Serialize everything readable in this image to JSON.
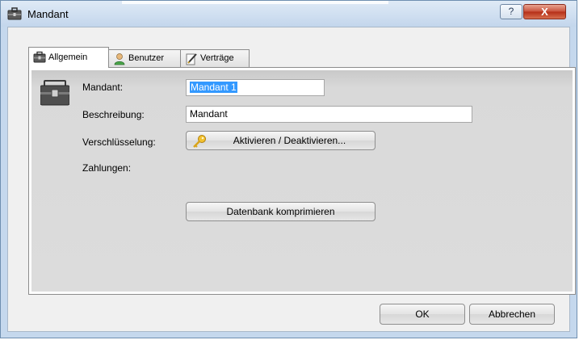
{
  "window": {
    "title": "Mandant",
    "help_label": "?",
    "close_label": "X"
  },
  "tabs": [
    {
      "label": "Allgemein",
      "icon": "briefcase-icon",
      "active": true
    },
    {
      "label": "Benutzer",
      "icon": "user-icon",
      "active": false
    },
    {
      "label": "Verträge",
      "icon": "pen-paper-icon",
      "active": false
    }
  ],
  "form": {
    "mandant_label": "Mandant:",
    "mandant_value": "Mandant 1",
    "beschreibung_label": "Beschreibung:",
    "beschreibung_value": "Mandant",
    "verschluesselung_label": "Verschlüsselung:",
    "encrypt_button_label": "Aktivieren / Deaktivieren...",
    "zahlungen_label": "Zahlungen:",
    "compress_button_label": "Datenbank komprimieren"
  },
  "footer": {
    "ok_label": "OK",
    "cancel_label": "Abbrechen"
  }
}
